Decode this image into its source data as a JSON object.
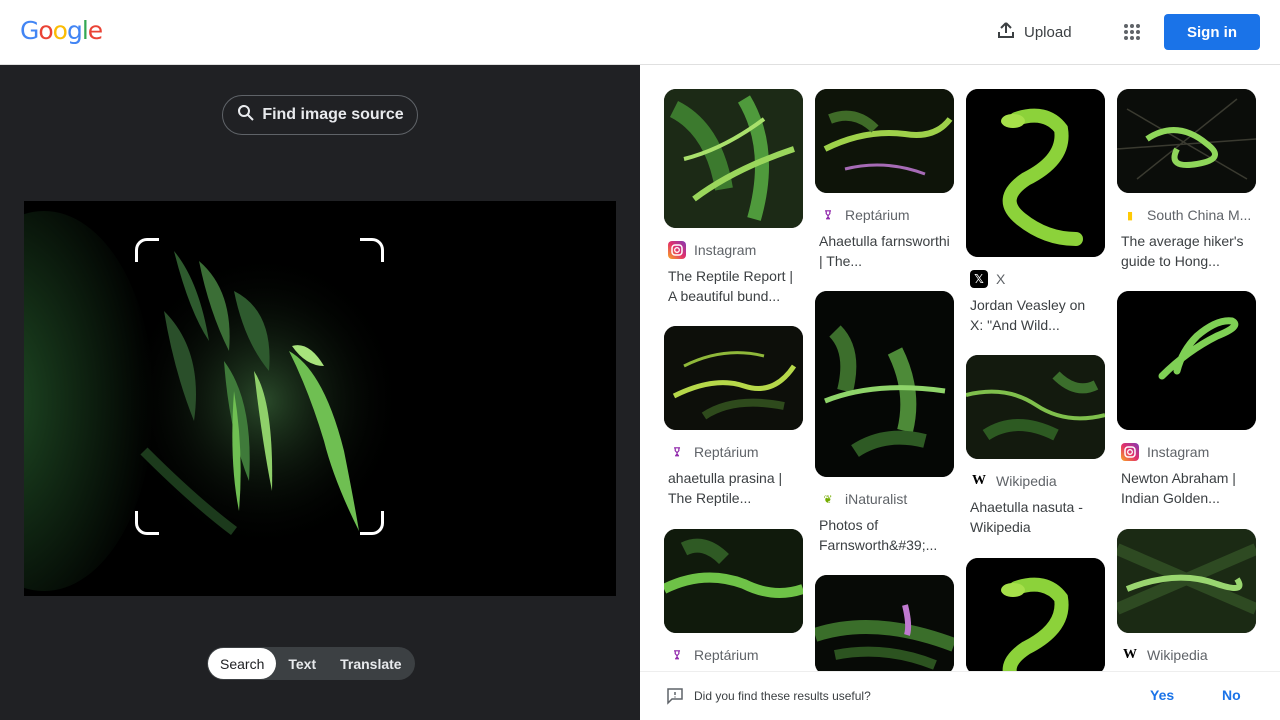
{
  "header": {
    "logo_letters": [
      "G",
      "o",
      "o",
      "g",
      "l",
      "e"
    ],
    "logo_colors": [
      "#4285f4",
      "#ea4335",
      "#fbbc05",
      "#4285f4",
      "#34a853",
      "#ea4335"
    ],
    "upload_label": "Upload",
    "upload_icon": "upload-icon",
    "apps_icon": "apps-grid-icon",
    "signin_label": "Sign in"
  },
  "left": {
    "find_source_label": "Find image source",
    "modes": [
      "Search",
      "Text",
      "Translate"
    ],
    "active_mode": "Search"
  },
  "results": [
    {
      "source": "Instagram",
      "title": "The Reptile Report | A beautiful bund...",
      "favicon": "instagram-icon",
      "fav_color": "#e1306c"
    },
    {
      "source": "Reptárium",
      "title": "ahaetulla prasina | The Reptile...",
      "favicon": "reptarium-icon",
      "fav_color": "#8e24aa"
    },
    {
      "source": "Reptárium",
      "title": "",
      "favicon": "reptarium-icon",
      "fav_color": "#8e24aa"
    },
    {
      "source": "Reptárium",
      "title": "Ahaetulla farnsworthi | The...",
      "favicon": "reptarium-icon",
      "fav_color": "#8e24aa"
    },
    {
      "source": "iNaturalist",
      "title": "Photos of Farnsworth&#39;...",
      "favicon": "inaturalist-icon",
      "fav_color": "#74ac00"
    },
    {
      "source": "X",
      "title": "Jordan Veasley on X: \"And Wild...",
      "favicon": "x-icon",
      "fav_color": "#000000"
    },
    {
      "source": "Wikipedia",
      "title": "Ahaetulla nasuta - Wikipedia",
      "favicon": "wikipedia-icon",
      "fav_color": "#000000"
    },
    {
      "source": "South China M...",
      "title": "The average hiker's guide to Hong...",
      "favicon": "scmp-icon",
      "fav_color": "#ffca05"
    },
    {
      "source": "Instagram",
      "title": "Newton Abraham | Indian Golden...",
      "favicon": "instagram-icon",
      "fav_color": "#e1306c"
    },
    {
      "source": "Wikipedia",
      "title": "",
      "favicon": "wikipedia-icon",
      "fav_color": "#000000"
    }
  ],
  "feedback": {
    "question": "Did you find these results useful?",
    "yes": "Yes",
    "no": "No"
  }
}
